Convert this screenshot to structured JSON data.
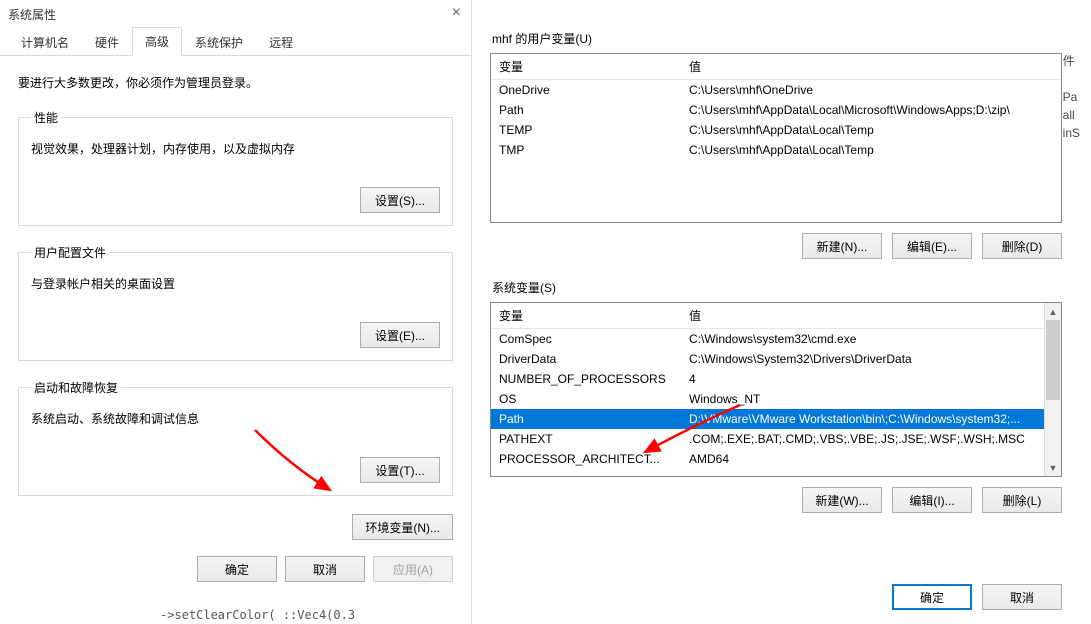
{
  "sysprops": {
    "title": "系统属性",
    "tabs": [
      "计算机名",
      "硬件",
      "高级",
      "系统保护",
      "远程"
    ],
    "instruction": "要进行大多数更改，你必须作为管理员登录。",
    "performance": {
      "legend": "性能",
      "desc": "视觉效果，处理器计划，内存使用，以及虚拟内存",
      "btn": "设置(S)..."
    },
    "userprofiles": {
      "legend": "用户配置文件",
      "desc": "与登录帐户相关的桌面设置",
      "btn": "设置(E)..."
    },
    "startup": {
      "legend": "启动和故障恢复",
      "desc": "系统启动、系统故障和调试信息",
      "btn": "设置(T)..."
    },
    "envvar_btn": "环境变量(N)...",
    "ok": "确定",
    "cancel": "取消",
    "apply": "应用(A)"
  },
  "envvars": {
    "user_section": "mhf 的用户变量(U)",
    "sys_section": "系统变量(S)",
    "col_var": "变量",
    "col_val": "值",
    "user_rows": [
      {
        "name": "OneDrive",
        "value": "C:\\Users\\mhf\\OneDrive"
      },
      {
        "name": "Path",
        "value": "C:\\Users\\mhf\\AppData\\Local\\Microsoft\\WindowsApps;D:\\zip\\"
      },
      {
        "name": "TEMP",
        "value": "C:\\Users\\mhf\\AppData\\Local\\Temp"
      },
      {
        "name": "TMP",
        "value": "C:\\Users\\mhf\\AppData\\Local\\Temp"
      }
    ],
    "sys_rows": [
      {
        "name": "ComSpec",
        "value": "C:\\Windows\\system32\\cmd.exe",
        "sel": false
      },
      {
        "name": "DriverData",
        "value": "C:\\Windows\\System32\\Drivers\\DriverData",
        "sel": false
      },
      {
        "name": "NUMBER_OF_PROCESSORS",
        "value": "4",
        "sel": false
      },
      {
        "name": "OS",
        "value": "Windows_NT",
        "sel": false
      },
      {
        "name": "Path",
        "value": "D:\\VMware\\VMware Workstation\\bin\\;C:\\Windows\\system32;...",
        "sel": true
      },
      {
        "name": "PATHEXT",
        "value": ".COM;.EXE;.BAT;.CMD;.VBS;.VBE;.JS;.JSE;.WSF;.WSH;.MSC",
        "sel": false
      },
      {
        "name": "PROCESSOR_ARCHITECT...",
        "value": "AMD64",
        "sel": false
      }
    ],
    "btn_new_user": "新建(N)...",
    "btn_edit_user": "编辑(E)...",
    "btn_del_user": "删除(D)",
    "btn_new_sys": "新建(W)...",
    "btn_edit_sys": "编辑(I)...",
    "btn_del_sys": "删除(L)",
    "ok": "确定",
    "cancel": "取消"
  },
  "bg": {
    "l1": "件",
    "l2": "Pa",
    "l3": "all",
    "l4": "inS"
  },
  "bottom_code": "  ->setClearColor( ::Vec4(0.3"
}
